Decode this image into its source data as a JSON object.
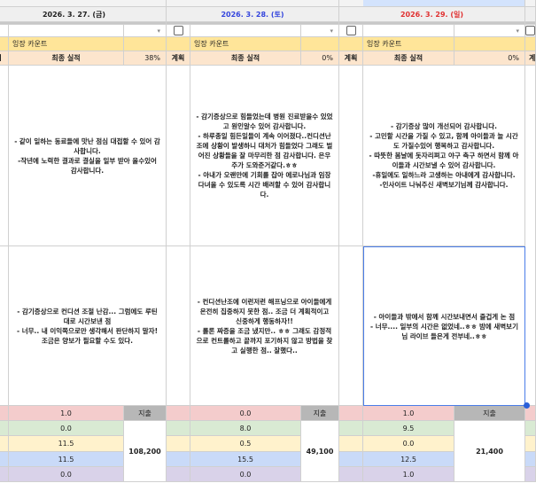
{
  "days": [
    {
      "date": "2026. 3. 27. (금)",
      "date_color": "#222222",
      "category": "잉장 카운트",
      "plan_label": "계획",
      "final_label": "최종 실적",
      "percent": "38%",
      "comment1": "- 같이 일하는 동료들에 맛난 점심 대접할 수 있어 감사합니다.\n-작년에 노력한 결과로 결실을 일부 받아 올수있어 감사합니다.",
      "comment2": "- 감기증상으로 컨디션 조절 난감... 그럼에도 루틴대로 시간보낸 점\n- 너무.. 내 이익쪽으로만 생각해서 판단하지 말자! 조금은 양보가 필요할 수도 있다.",
      "values": [
        "1.0",
        "0.0",
        "11.5",
        "11.5",
        "0.0"
      ],
      "expense_label": "지출",
      "expense": "108,200"
    },
    {
      "date": "2026. 3. 28. (토)",
      "date_color": "#3344dd",
      "category": "잉장 카운트",
      "plan_label": "계획",
      "final_label": "최종 실적",
      "percent": "0%",
      "comment1": "- 감기증상으로 힘들었는데 병원 진료받을수 있었고 원인알수 있어 감사합니다.\n- 하루종일 힘든일들이 계속 이어졌다..컨디션난조에 상황이 발생하니 대처가 힘들었다 그래도 벌어진 상황들을 잘 마무리한 점 감사합니다. 은우주가 도와준거같다.ㅎㅎ\n- 아내가 오랜만에 기회를 잡아 에로나님과 임장 다녀올 수 있도록 시간 배려할 수 있어 감사합니다.",
      "comment2": "- 컨디션난조에 이런저런 해프닝으로 아이들에게 온전히 집중하지 못한 점.. 조금 더 계획적이고 신중하게 행동하자!!\n- 롤론 짜증을 조금 냈지만.. ㅎㅎ 그래도 감정적으로 컨트롤하고 끝까지 포기하지 않고 방법을 찾고 실행한 점.. 잘했다..",
      "values": [
        "0.0",
        "8.0",
        "0.5",
        "15.5",
        "0.0"
      ],
      "expense_label": "지출",
      "expense": "49,100"
    },
    {
      "date": "2026. 3. 29. (일)",
      "date_color": "#e03030",
      "category": "잉장 카운트",
      "plan_label": "계획",
      "final_label": "최종 실적",
      "percent": "0%",
      "comment1": "- 감기증상 많이 개선되어 감사합니다.\n- 고민할 시간을 가질 수 있고, 함께 아이들과 놀 시간도 가질수있어 행복하고 감사합니다.\n- 따뜻한 봄날에 돗자리펴고 야구 축구 하면서 함께 아이들과 시간보낼 수 있어 감사합니다.\n-휴일에도 일하느라 고생하는 아내에게 감사합니다.\n-인사이트 나눠주신 새벽보기님께 감사합니다.",
      "comment2": "- 아이들과 밖에서 함께 시간보내면서 즐겁게 논 점\n- 너무.... 일부의 시간은 없었네..ㅎㅎ 밤에 새벽보기님 라이브 들은게 전부네..ㅎㅎ",
      "values": [
        "1.0",
        "9.5",
        "0.0",
        "12.5",
        "1.0"
      ],
      "expense_label": "지출",
      "expense": "21,400"
    }
  ],
  "next_plan_label": "계",
  "row_colors": [
    "#f4cccc",
    "#d9ead3",
    "#fff2cc",
    "#c9daf8",
    "#d9d2e9"
  ]
}
